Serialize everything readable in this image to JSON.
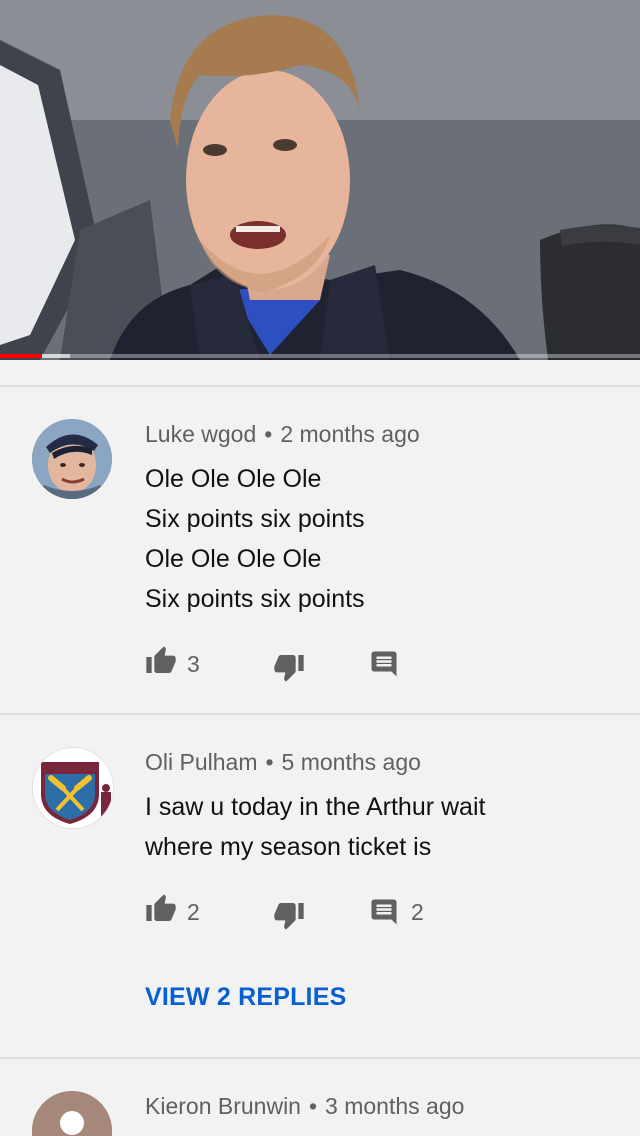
{
  "video": {
    "progress": 0.065,
    "buffered": 0.11,
    "accent_color": "#ff0000"
  },
  "comments": [
    {
      "author": "Luke wgod",
      "time": "2 months ago",
      "lines": [
        "Ole Ole Ole Ole",
        "Six points six points",
        "Ole Ole Ole Ole",
        "Six points six points"
      ],
      "likes": "3",
      "replies_count": ""
    },
    {
      "author": "Oli Pulham",
      "time": "5 months ago",
      "lines": [
        "I saw u today in the Arthur wait",
        "where my season ticket is"
      ],
      "likes": "2",
      "replies_count": "2",
      "view_replies": "VIEW 2 REPLIES",
      "avatar_badge": {
        "line1": "WEST HAM",
        "line2": "UNITED",
        "line3": "LONDON"
      }
    },
    {
      "author": "Kieron Brunwin",
      "time": "3 months ago"
    }
  ],
  "separator": "•",
  "icons": [
    "thumb-up-icon",
    "thumb-down-icon",
    "reply-icon"
  ]
}
